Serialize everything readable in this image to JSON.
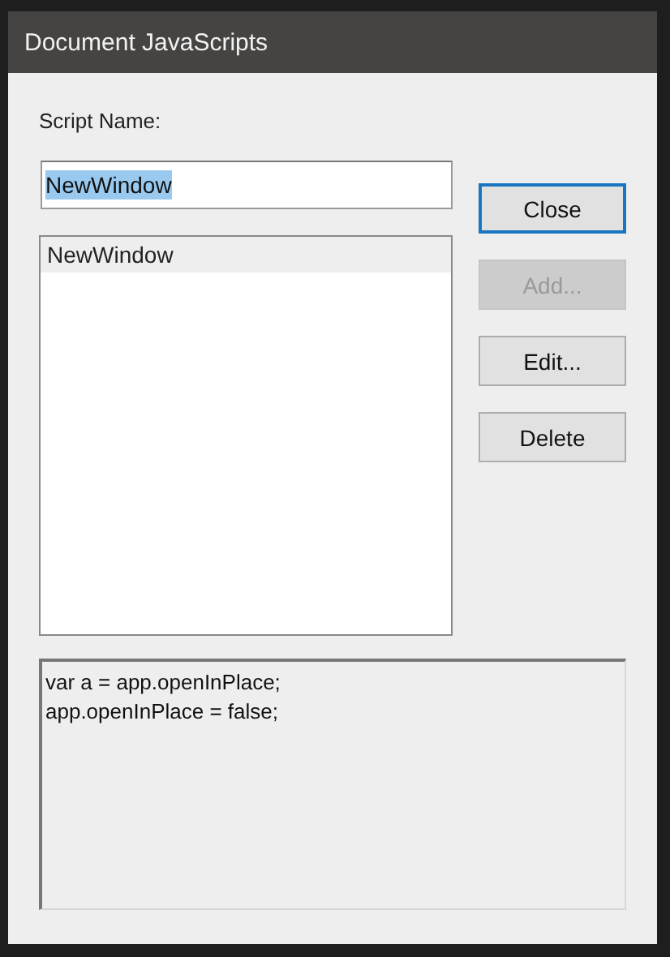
{
  "window": {
    "title": "Document JavaScripts"
  },
  "script_name": {
    "label": "Script Name:",
    "value": "NewWindow",
    "text_selected": true
  },
  "scripts": [
    {
      "name": "NewWindow",
      "selected": true
    }
  ],
  "buttons": [
    {
      "label": "Close",
      "disabled": false,
      "focused": true
    },
    {
      "label": "Add...",
      "disabled": true,
      "focused": false
    },
    {
      "label": "Edit...",
      "disabled": false,
      "focused": false
    },
    {
      "label": "Delete",
      "disabled": false,
      "focused": false
    }
  ],
  "code_lines": [
    "var a = app.openInPlace;",
    "app.openInPlace = false;"
  ]
}
